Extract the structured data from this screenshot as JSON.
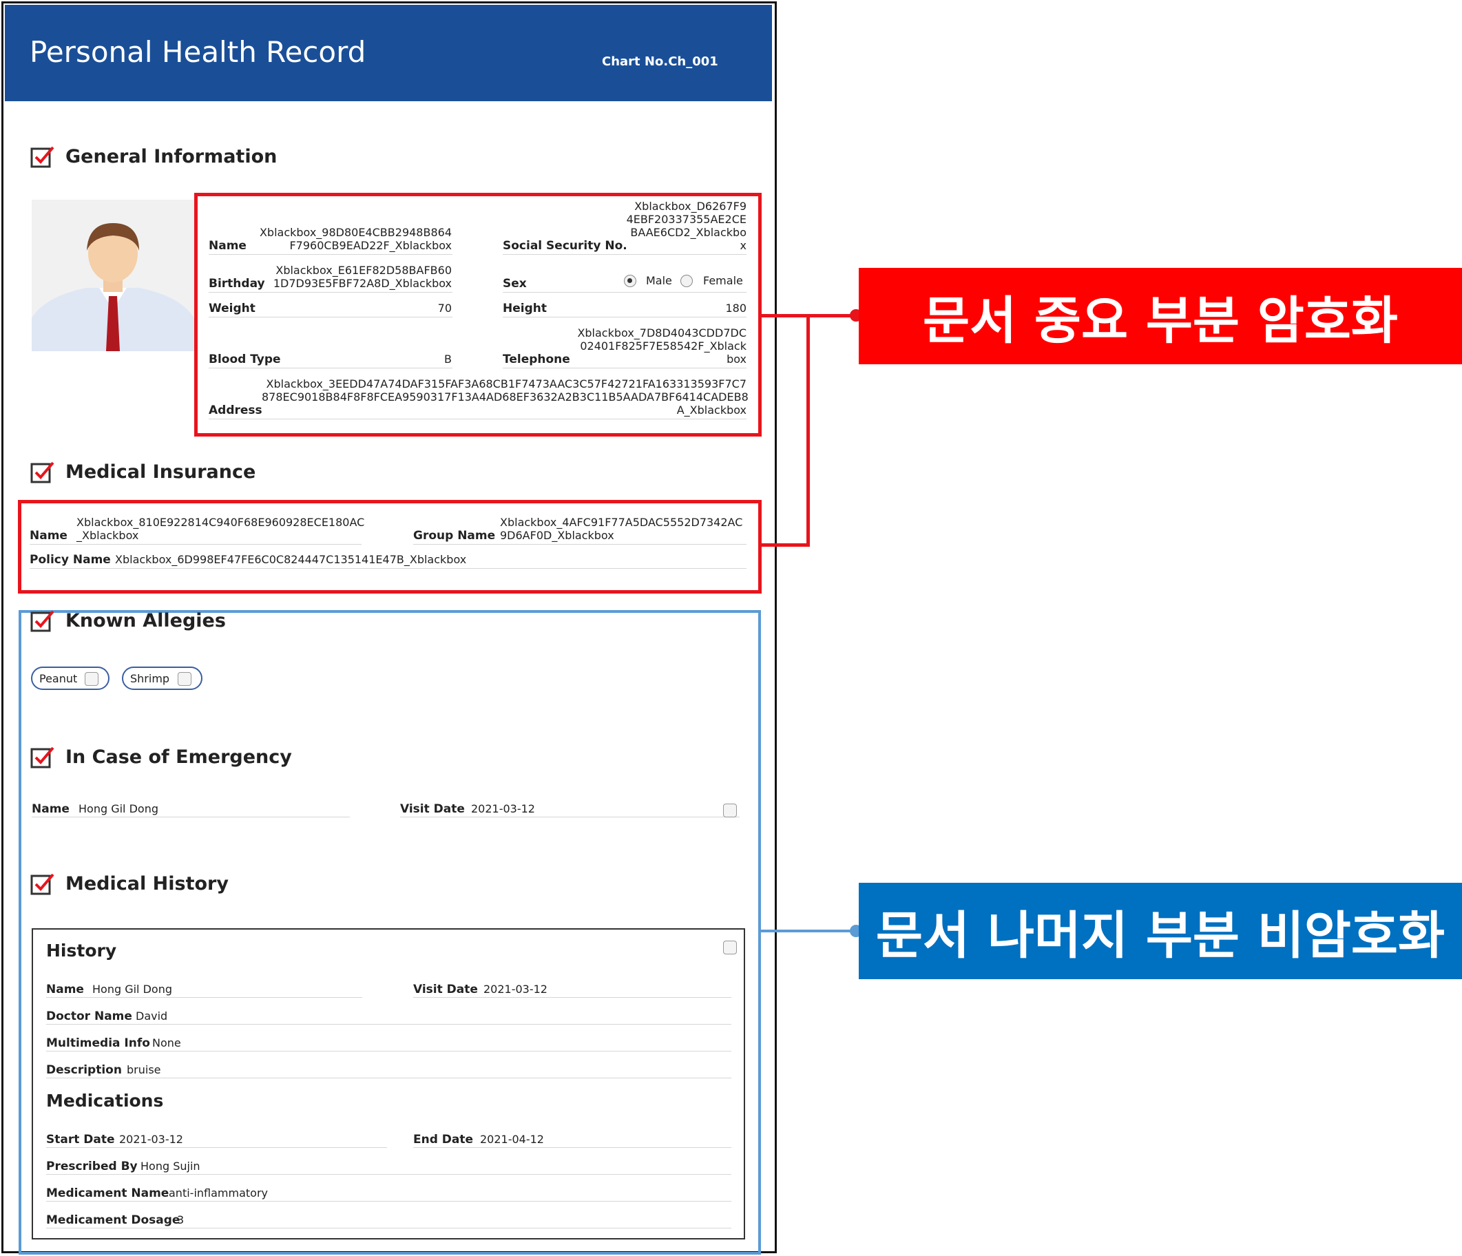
{
  "header": {
    "title": "Personal Health Record",
    "chart_no": "Chart No.Ch_001"
  },
  "general": {
    "title": "General Information",
    "name_label": "Name",
    "name_value_1": "Xblackbox_98D80E4CBB2948B864",
    "name_value_2": "F7960CB9EAD22F_Xblackbox",
    "ssn_label": "Social Security No.",
    "ssn_value_1": "Xblackbox_D6267F9",
    "ssn_value_2": "4EBF20337355AE2CE",
    "ssn_value_3": "BAAE6CD2_Xblackbo",
    "ssn_value_4": "x",
    "birthday_label": "Birthday",
    "birthday_value_1": "Xblackbox_E61EF82D58BAFB60",
    "birthday_value_2": "1D7D93E5FBF72A8D_Xblackbox",
    "sex_label": "Sex",
    "male_label": "Male",
    "female_label": "Female",
    "weight_label": "Weight",
    "weight_value": "70",
    "height_label": "Height",
    "height_value": "180",
    "blood_label": "Blood Type",
    "blood_value": "B",
    "tel_label": "Telephone",
    "tel_value_1": "Xblackbox_7D8D4043CDD7DC",
    "tel_value_2": "02401F825F7E58542F_Xblack",
    "tel_value_3": "box",
    "address_label": "Address",
    "address_value_1": "Xblackbox_3EEDD47A74DAF315FAF3A68CB1F7473AAC3C57F42721FA163313593F7C7",
    "address_value_2": "878EC9018B84F8F8FCEA9590317F13A4AD68EF3632A2B3C11B5AADA7BF6414CADEB8",
    "address_value_3": "A_Xblackbox"
  },
  "insurance": {
    "title": "Medical Insurance",
    "name_label": "Name",
    "name_value_1": "Xblackbox_810E922814C940F68E960928ECE180AC",
    "name_value_2": "_Xblackbox",
    "group_label": "Group Name",
    "group_value_1": "Xblackbox_4AFC91F77A5DAC5552D7342AC",
    "group_value_2": "9D6AF0D_Xblackbox",
    "policy_label": "Policy Name",
    "policy_value": "Xblackbox_6D998EF47FE6C0C824447C135141E47B_Xblackbox"
  },
  "allergies": {
    "title": "Known Allegies",
    "items": [
      "Peanut",
      "Shrimp"
    ]
  },
  "emergency": {
    "title": "In Case of Emergency",
    "name_label": "Name",
    "name_value": "Hong Gil Dong",
    "visit_label": "Visit Date",
    "visit_value": "2021-03-12"
  },
  "history": {
    "title": "Medical History",
    "box_title": "History",
    "name_label": "Name",
    "name_value": "Hong Gil Dong",
    "visit_label": "Visit Date",
    "visit_value": "2021-03-12",
    "doctor_label": "Doctor Name",
    "doctor_value": "David",
    "multimedia_label": "Multimedia Info",
    "multimedia_value": "None",
    "description_label": "Description",
    "description_value": "bruise"
  },
  "medications": {
    "title": "Medications",
    "start_label": "Start Date",
    "start_value": "2021-03-12",
    "end_label": "End Date",
    "end_value": "2021-04-12",
    "prescribed_label": "Prescribed By",
    "prescribed_value": "Hong Sujin",
    "name_label": "Medicament Name",
    "name_value": "anti-inflammatory",
    "dosage_label": "Medicament Dosage",
    "dosage_value": "3"
  },
  "callouts": {
    "encrypted": "문서 중요 부분 암호화",
    "unencrypted": "문서 나머지 부분 비암호화"
  },
  "colors": {
    "header_bg": "#1a4f98",
    "encrypted": "#e8141c",
    "unencrypted": "#0070c0",
    "outline_blue": "#5b9bd5"
  }
}
